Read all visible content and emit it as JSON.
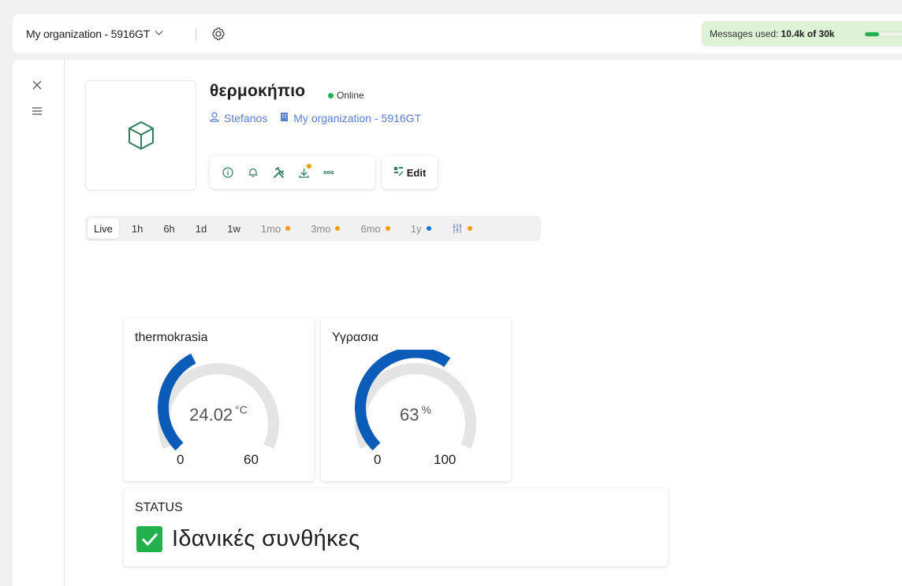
{
  "topbar": {
    "org_name": "My organization - 5916GT",
    "messages_prefix": "Messages used:",
    "messages_used": "10.4k of 30k",
    "messages_fraction": 0.35
  },
  "device": {
    "name": "θερμοκήπιο",
    "status": "Online",
    "owner": "Stefanos",
    "organization": "My organization - 5916GT",
    "edit_label": "Edit"
  },
  "time_ranges": [
    {
      "label": "Live",
      "active": true
    },
    {
      "label": "1h"
    },
    {
      "label": "6h"
    },
    {
      "label": "1d"
    },
    {
      "label": "1w"
    },
    {
      "label": "1mo",
      "dot": "#f39c12"
    },
    {
      "label": "3mo",
      "dot": "#f39c12"
    },
    {
      "label": "6mo",
      "dot": "#f39c12"
    },
    {
      "label": "1y",
      "dot": "#1a73e8"
    }
  ],
  "widgets": {
    "temperature": {
      "title": "thermokrasia",
      "value": "24.02",
      "unit": "°C",
      "min": "0",
      "max": "60",
      "fraction": 0.4003
    },
    "humidity": {
      "title": "Υγρασια",
      "value": "63",
      "unit": "%",
      "min": "0",
      "max": "100",
      "fraction": 0.63
    },
    "status": {
      "title": "STATUS",
      "value": "Ιδανικές συνθήκες"
    }
  },
  "colors": {
    "accent": "#0a5cb8",
    "track": "#e4e4e4",
    "online": "#22b14c",
    "link": "#5a7fd0"
  }
}
